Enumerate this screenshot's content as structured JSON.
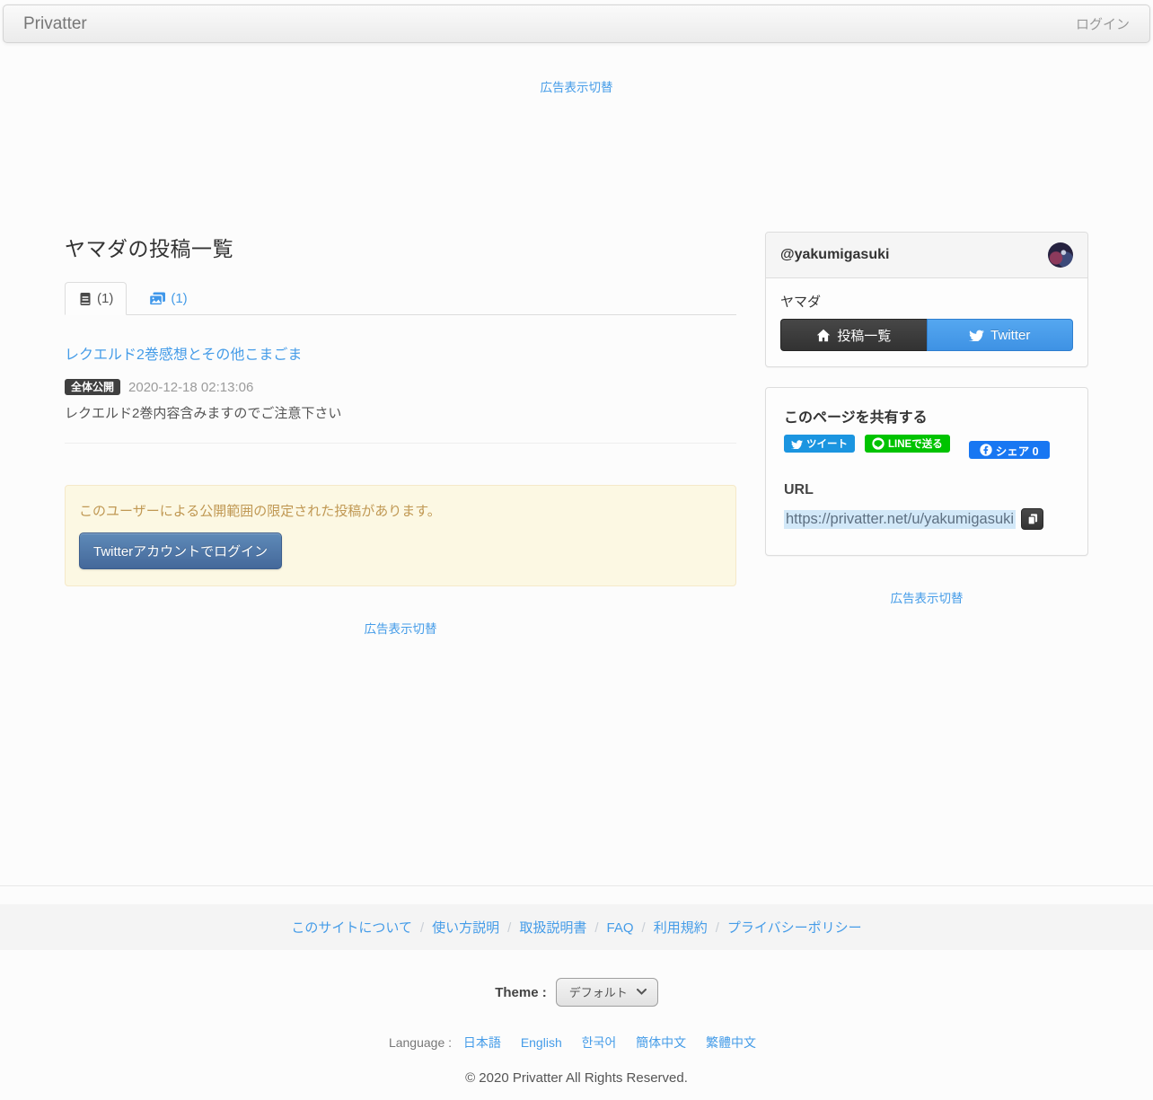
{
  "navbar": {
    "brand": "Privatter",
    "login_label": "ログイン"
  },
  "ad_toggle_label": "広告表示切替",
  "main": {
    "title": "ヤマダの投稿一覧",
    "tabs": [
      {
        "icon": "text-posts-icon",
        "count": "(1)"
      },
      {
        "icon": "image-posts-icon",
        "count": "(1)"
      }
    ],
    "post": {
      "title": "レクエルド2巻感想とその他こまごま",
      "badge": "全体公開",
      "date": "2020-12-18 02:13:06",
      "description": "レクエルド2巻内容含みますのでご注意下さい"
    },
    "alert": {
      "message": "このユーザーによる公開範囲の限定された投稿があります。",
      "login_button": "Twitterアカウントでログイン"
    }
  },
  "sidebar": {
    "profile": {
      "handle": "@yakumigasuki",
      "name": "ヤマダ",
      "posts_button": "投稿一覧",
      "twitter_button": "Twitter"
    },
    "share": {
      "title": "このページを共有する",
      "tweet_button": "ツイート",
      "line_button": "LINEで送る",
      "facebook_button": "シェア 0",
      "url_label": "URL",
      "url": "https://privatter.net/u/yakumigasuki"
    }
  },
  "footer": {
    "links": [
      "このサイトについて",
      "使い方説明",
      "取扱説明書",
      "FAQ",
      "利用規約",
      "プライバシーポリシー"
    ],
    "separator": "/",
    "theme_label": "Theme :",
    "theme_value": "デフォルト",
    "language_label": "Language :",
    "languages": [
      "日本語",
      "English",
      "한국어",
      "簡体中文",
      "繁體中文"
    ],
    "copyright": "© 2020 Privatter All Rights Reserved."
  },
  "colors": {
    "link": "#459ce8",
    "twitter": "#1b95e0",
    "line": "#00c300",
    "facebook": "#1877f2",
    "alert_text": "#c09853",
    "alert_bg": "#fcf8e3"
  }
}
